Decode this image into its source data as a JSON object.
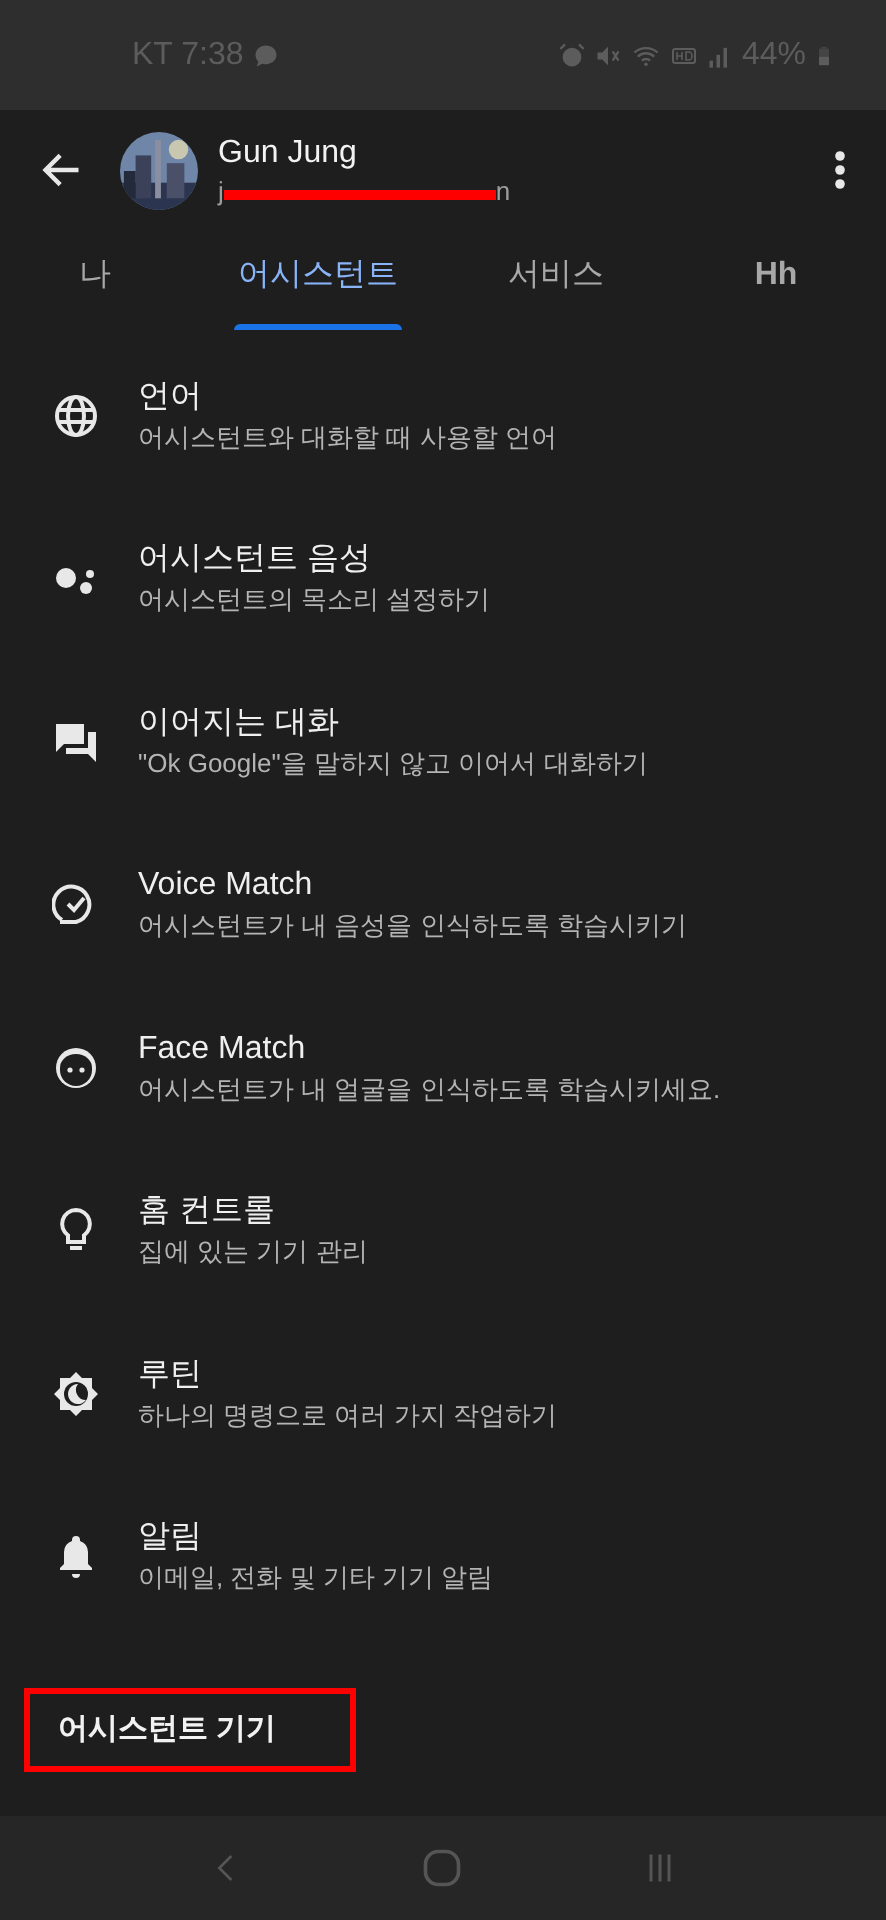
{
  "status_bar": {
    "carrier_time": "KT 7:38",
    "battery": "44%"
  },
  "account": {
    "name": "Gun Jung",
    "email_start": "j",
    "email_end": "n",
    "email_redacted": true
  },
  "tabs": [
    {
      "label": "나",
      "selected": false
    },
    {
      "label": "어시스턴트",
      "selected": true
    },
    {
      "label": "서비스",
      "selected": false
    },
    {
      "label": "Hh",
      "selected": false
    }
  ],
  "settings": [
    {
      "title": "언어",
      "subtitle": "어시스턴트와 대화할 때 사용할 언어"
    },
    {
      "title": "어시스턴트 음성",
      "subtitle": "어시스턴트의 목소리 설정하기"
    },
    {
      "title": "이어지는 대화",
      "subtitle": "\"Ok Google\"을 말하지 않고 이어서 대화하기"
    },
    {
      "title": "Voice Match",
      "subtitle": "어시스턴트가 내 음성을 인식하도록 학습시키기"
    },
    {
      "title": "Face Match",
      "subtitle": "어시스턴트가 내 얼굴을 인식하도록 학습시키세요."
    },
    {
      "title": "홈 컨트롤",
      "subtitle": "집에 있는 기기 관리"
    },
    {
      "title": "루틴",
      "subtitle": "하나의 명령으로 여러 가지 작업하기"
    },
    {
      "title": "알림",
      "subtitle": "이메일, 전화 및 기타 기기 알림"
    }
  ],
  "section": {
    "title": "어시스턴트 기기",
    "highlighted": true
  }
}
